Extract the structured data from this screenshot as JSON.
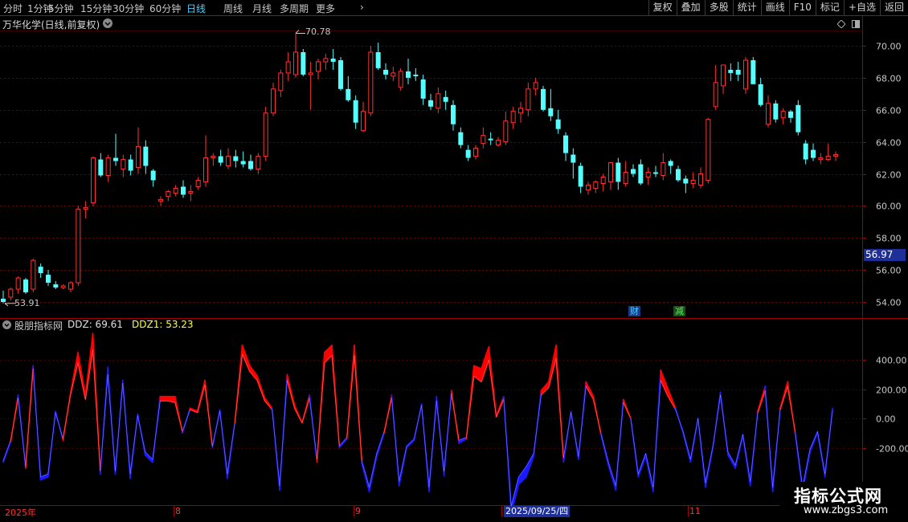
{
  "toolbar": {
    "periods": [
      "分时",
      "1分钟",
      "5分钟",
      "15分钟",
      "30分钟",
      "60分钟",
      "日线",
      "周线",
      "月线",
      "多周期",
      "更多"
    ],
    "active_period": "日线",
    "more_arrow": "›",
    "buttons": [
      "复权",
      "叠加",
      "多股",
      "统计",
      "画线",
      "F10",
      "标记",
      "+自选",
      "返回"
    ]
  },
  "title": {
    "name": "万华化学(日线,前复权)",
    "collapse_icon": "chevron-down-icon"
  },
  "price_panel": {
    "high_label": "70.78",
    "low_label": "53.91",
    "current_price": "56.97",
    "badges": [
      {
        "text": "财",
        "color": "#4dd0ff",
        "bg": "#1a3a8a"
      },
      {
        "text": "减",
        "color": "#3dff3d",
        "bg": "#1e4a1e"
      }
    ]
  },
  "indicator": {
    "name": "股朋指标网",
    "ddz_label": "DDZ: 69.61",
    "ddz1_label": "DDZ1: 53.23"
  },
  "date_axis": {
    "labels": [
      "2025年",
      "8",
      "9",
      "11"
    ],
    "cursor_label": "2025/09/25/四"
  },
  "watermark": {
    "title": "指标公式网",
    "url": "www.zbgs3.com"
  },
  "chart_data": [
    {
      "type": "candlestick",
      "title": "万华化学(日线,前复权)",
      "ylim": [
        53.0,
        71.0
      ],
      "yticks": [
        54.0,
        56.0,
        58.0,
        60.0,
        62.0,
        64.0,
        66.0,
        68.0,
        70.0
      ],
      "y_tick_labels": [
        "54.00",
        "56.00",
        "58.00",
        "60.00",
        "62.00",
        "64.00",
        "66.00",
        "68.00",
        "70.00"
      ],
      "high_annotation": 70.78,
      "low_annotation": 53.91,
      "last_price": 56.97,
      "colors": {
        "up": "#ff3232",
        "down": "#54ffff",
        "grid": "#6b0000"
      },
      "ohlc": [
        [
          54.2,
          54.7,
          53.91,
          54.0
        ],
        [
          54.3,
          54.9,
          54.1,
          54.8
        ],
        [
          54.8,
          55.6,
          54.5,
          55.5
        ],
        [
          55.4,
          55.5,
          54.5,
          54.6
        ],
        [
          54.8,
          56.7,
          54.6,
          56.6
        ],
        [
          56.2,
          56.4,
          55.5,
          55.8
        ],
        [
          55.7,
          56.0,
          55.0,
          55.2
        ],
        [
          55.1,
          55.3,
          54.8,
          54.9
        ],
        [
          54.9,
          55.1,
          54.8,
          55.0
        ],
        [
          54.8,
          55.3,
          54.6,
          55.2
        ],
        [
          55.2,
          60.0,
          55.0,
          59.8
        ],
        [
          59.8,
          60.3,
          59.2,
          59.9
        ],
        [
          60.2,
          63.1,
          60.0,
          63.0
        ],
        [
          62.9,
          63.3,
          61.8,
          61.9
        ],
        [
          61.9,
          63.2,
          61.5,
          63.0
        ],
        [
          63.0,
          64.5,
          62.5,
          62.8
        ],
        [
          62.3,
          63.2,
          61.8,
          62.9
        ],
        [
          62.9,
          63.2,
          61.9,
          62.2
        ],
        [
          62.4,
          64.9,
          62.0,
          63.7
        ],
        [
          63.7,
          64.1,
          62.0,
          62.5
        ],
        [
          62.2,
          62.3,
          61.2,
          61.6
        ],
        [
          60.3,
          60.6,
          60.0,
          60.4
        ],
        [
          60.6,
          61.0,
          60.3,
          60.9
        ],
        [
          60.8,
          61.3,
          60.6,
          61.1
        ],
        [
          61.2,
          61.6,
          60.5,
          60.7
        ],
        [
          60.8,
          61.3,
          60.3,
          60.9
        ],
        [
          61.2,
          61.8,
          61.0,
          61.6
        ],
        [
          61.5,
          64.4,
          61.2,
          63.0
        ],
        [
          63.0,
          63.3,
          62.5,
          63.1
        ],
        [
          63.1,
          63.5,
          62.5,
          62.7
        ],
        [
          62.5,
          63.6,
          62.3,
          63.1
        ],
        [
          63.1,
          63.5,
          62.4,
          62.8
        ],
        [
          62.8,
          63.4,
          62.4,
          62.6
        ],
        [
          62.8,
          63.2,
          62.2,
          62.3
        ],
        [
          62.3,
          63.3,
          62.0,
          63.1
        ],
        [
          63.1,
          66.2,
          62.8,
          65.8
        ],
        [
          65.8,
          67.7,
          65.6,
          67.3
        ],
        [
          67.2,
          68.5,
          66.8,
          68.3
        ],
        [
          68.3,
          69.6,
          67.8,
          69.0
        ],
        [
          68.2,
          70.78,
          68.0,
          69.6
        ],
        [
          69.6,
          69.8,
          68.1,
          68.2
        ],
        [
          68.2,
          69.0,
          66.0,
          68.3
        ],
        [
          68.4,
          69.2,
          67.9,
          69.0
        ],
        [
          69.0,
          69.5,
          68.5,
          69.2
        ],
        [
          69.2,
          69.8,
          68.5,
          69.0
        ],
        [
          69.1,
          69.3,
          67.2,
          67.3
        ],
        [
          67.3,
          68.1,
          66.5,
          66.6
        ],
        [
          66.6,
          66.9,
          64.8,
          65.2
        ],
        [
          64.7,
          66.5,
          64.6,
          65.9
        ],
        [
          65.8,
          70.0,
          65.6,
          69.6
        ],
        [
          69.6,
          70.2,
          68.5,
          68.6
        ],
        [
          68.5,
          68.9,
          67.9,
          68.2
        ],
        [
          68.1,
          68.7,
          67.8,
          68.3
        ],
        [
          67.4,
          68.6,
          67.2,
          68.4
        ],
        [
          68.4,
          69.2,
          67.6,
          68.0
        ],
        [
          68.2,
          68.6,
          67.8,
          68.1
        ],
        [
          67.9,
          68.2,
          66.3,
          66.7
        ],
        [
          66.6,
          67.0,
          66.0,
          66.2
        ],
        [
          66.1,
          67.4,
          65.8,
          67.0
        ],
        [
          66.8,
          67.2,
          66.0,
          66.5
        ],
        [
          66.3,
          66.6,
          64.7,
          65.1
        ],
        [
          64.6,
          64.9,
          63.6,
          63.8
        ],
        [
          63.5,
          63.8,
          62.8,
          63.0
        ],
        [
          63.1,
          63.8,
          62.9,
          63.6
        ],
        [
          63.9,
          64.9,
          63.6,
          64.4
        ],
        [
          64.2,
          64.6,
          63.8,
          64.1
        ],
        [
          63.8,
          64.3,
          63.7,
          64.1
        ],
        [
          64.0,
          65.9,
          63.8,
          65.3
        ],
        [
          65.2,
          66.2,
          64.8,
          65.9
        ],
        [
          65.8,
          66.5,
          65.2,
          66.1
        ],
        [
          66.0,
          67.7,
          65.6,
          67.3
        ],
        [
          67.3,
          68.0,
          66.9,
          67.7
        ],
        [
          67.3,
          67.5,
          65.9,
          66.0
        ],
        [
          66.1,
          67.3,
          65.3,
          65.6
        ],
        [
          65.4,
          66.0,
          64.5,
          64.8
        ],
        [
          64.4,
          64.6,
          62.8,
          63.3
        ],
        [
          63.2,
          63.6,
          61.7,
          62.7
        ],
        [
          62.5,
          62.7,
          60.8,
          61.2
        ],
        [
          61.0,
          61.5,
          60.7,
          61.3
        ],
        [
          61.1,
          61.6,
          60.8,
          61.5
        ],
        [
          61.4,
          62.0,
          60.9,
          61.8
        ],
        [
          61.5,
          62.7,
          61.0,
          62.7
        ],
        [
          62.7,
          63.0,
          61.0,
          61.5
        ],
        [
          61.4,
          62.8,
          61.2,
          62.1
        ],
        [
          62.3,
          62.6,
          61.8,
          62.0
        ],
        [
          62.6,
          62.9,
          61.3,
          61.4
        ],
        [
          61.8,
          62.4,
          61.3,
          62.1
        ],
        [
          62.1,
          62.5,
          61.8,
          62.0
        ],
        [
          61.9,
          63.3,
          61.6,
          62.7
        ],
        [
          62.8,
          62.9,
          62.0,
          62.5
        ],
        [
          62.3,
          62.5,
          61.5,
          61.6
        ],
        [
          61.7,
          61.9,
          60.8,
          61.4
        ],
        [
          61.4,
          62.1,
          61.1,
          61.6
        ],
        [
          61.3,
          62.4,
          61.1,
          62.0
        ],
        [
          61.6,
          65.5,
          61.4,
          65.4
        ],
        [
          66.2,
          68.8,
          66.0,
          67.7
        ],
        [
          67.5,
          68.7,
          67.0,
          68.8
        ],
        [
          68.5,
          68.9,
          67.8,
          68.3
        ],
        [
          68.5,
          69.0,
          67.8,
          68.2
        ],
        [
          67.3,
          69.3,
          67.0,
          69.1
        ],
        [
          69.1,
          69.3,
          67.7,
          67.6
        ],
        [
          67.6,
          68.0,
          66.2,
          66.3
        ],
        [
          65.1,
          66.9,
          64.9,
          66.4
        ],
        [
          66.4,
          66.6,
          65.2,
          65.4
        ],
        [
          65.5,
          66.1,
          65.1,
          65.9
        ],
        [
          65.9,
          66.0,
          65.2,
          65.5
        ],
        [
          66.3,
          66.6,
          64.4,
          64.6
        ],
        [
          63.9,
          64.1,
          62.6,
          62.9
        ],
        [
          63.5,
          63.9,
          62.8,
          63.0
        ],
        [
          62.9,
          63.3,
          62.6,
          63.0
        ],
        [
          62.9,
          63.9,
          62.8,
          63.1
        ],
        [
          63.1,
          63.4,
          62.8,
          63.2
        ]
      ],
      "badges": [
        {
          "text": "财",
          "candle_index": 84
        },
        {
          "text": "减",
          "candle_index": 90
        }
      ]
    },
    {
      "type": "area",
      "title": "股朋指标网",
      "ylim": [
        -620,
        640
      ],
      "yticks": [
        -200,
        0,
        200,
        400
      ],
      "y_tick_labels": [
        "-200.00",
        "0.00",
        "200.00",
        "400.00"
      ],
      "series": [
        {
          "name": "DDZ",
          "last": 69.61,
          "values": [
            -300,
            -160,
            160,
            -340,
            360,
            -420,
            -400,
            50,
            -150,
            170,
            450,
            160,
            580,
            -380,
            350,
            -380,
            260,
            -410,
            30,
            -250,
            -300,
            150,
            150,
            150,
            -100,
            70,
            50,
            260,
            -200,
            60,
            -410,
            -30,
            500,
            360,
            290,
            140,
            70,
            -490,
            300,
            90,
            -30,
            160,
            -300,
            450,
            500,
            -200,
            -140,
            500,
            -310,
            -500,
            -260,
            -100,
            160,
            -460,
            -200,
            -150,
            100,
            -500,
            150,
            -390,
            190,
            -170,
            -140,
            360,
            340,
            490,
            20,
            150,
            -650,
            -450,
            -400,
            -260,
            190,
            250,
            500,
            -300,
            50,
            -280,
            250,
            150,
            -110,
            -320,
            -490,
            130,
            0,
            -400,
            -260,
            -500,
            330,
            200,
            70,
            -100,
            -300,
            0,
            -470,
            -200,
            180,
            -250,
            -340,
            -120,
            -460,
            50,
            220,
            -500,
            70,
            250,
            -100,
            -500,
            -230,
            -100,
            -400,
            69.61
          ]
        },
        {
          "name": "DDZ1",
          "last": 53.23,
          "values": [
            -290,
            -150,
            140,
            -330,
            340,
            -400,
            -380,
            40,
            -140,
            160,
            380,
            130,
            470,
            -360,
            300,
            -360,
            240,
            -380,
            20,
            -230,
            -280,
            120,
            120,
            110,
            -90,
            60,
            40,
            230,
            -190,
            50,
            -380,
            -30,
            440,
            320,
            260,
            120,
            60,
            -460,
            260,
            70,
            -30,
            140,
            -280,
            380,
            430,
            -190,
            -130,
            430,
            -290,
            -470,
            -240,
            -90,
            140,
            -430,
            -190,
            -140,
            90,
            -470,
            120,
            -360,
            170,
            -150,
            -130,
            290,
            250,
            400,
            10,
            130,
            -600,
            -400,
            -330,
            -240,
            160,
            210,
            410,
            -270,
            40,
            -260,
            220,
            130,
            -100,
            -300,
            -460,
            110,
            0,
            -380,
            -240,
            -470,
            260,
            150,
            60,
            -90,
            -280,
            0,
            -440,
            -190,
            160,
            -230,
            -320,
            -110,
            -430,
            40,
            190,
            -470,
            60,
            220,
            -90,
            -470,
            -210,
            -90,
            -380,
            53.23
          ]
        }
      ],
      "colors": {
        "positive": "#ff0000",
        "negative": "#1a1aff"
      }
    }
  ]
}
